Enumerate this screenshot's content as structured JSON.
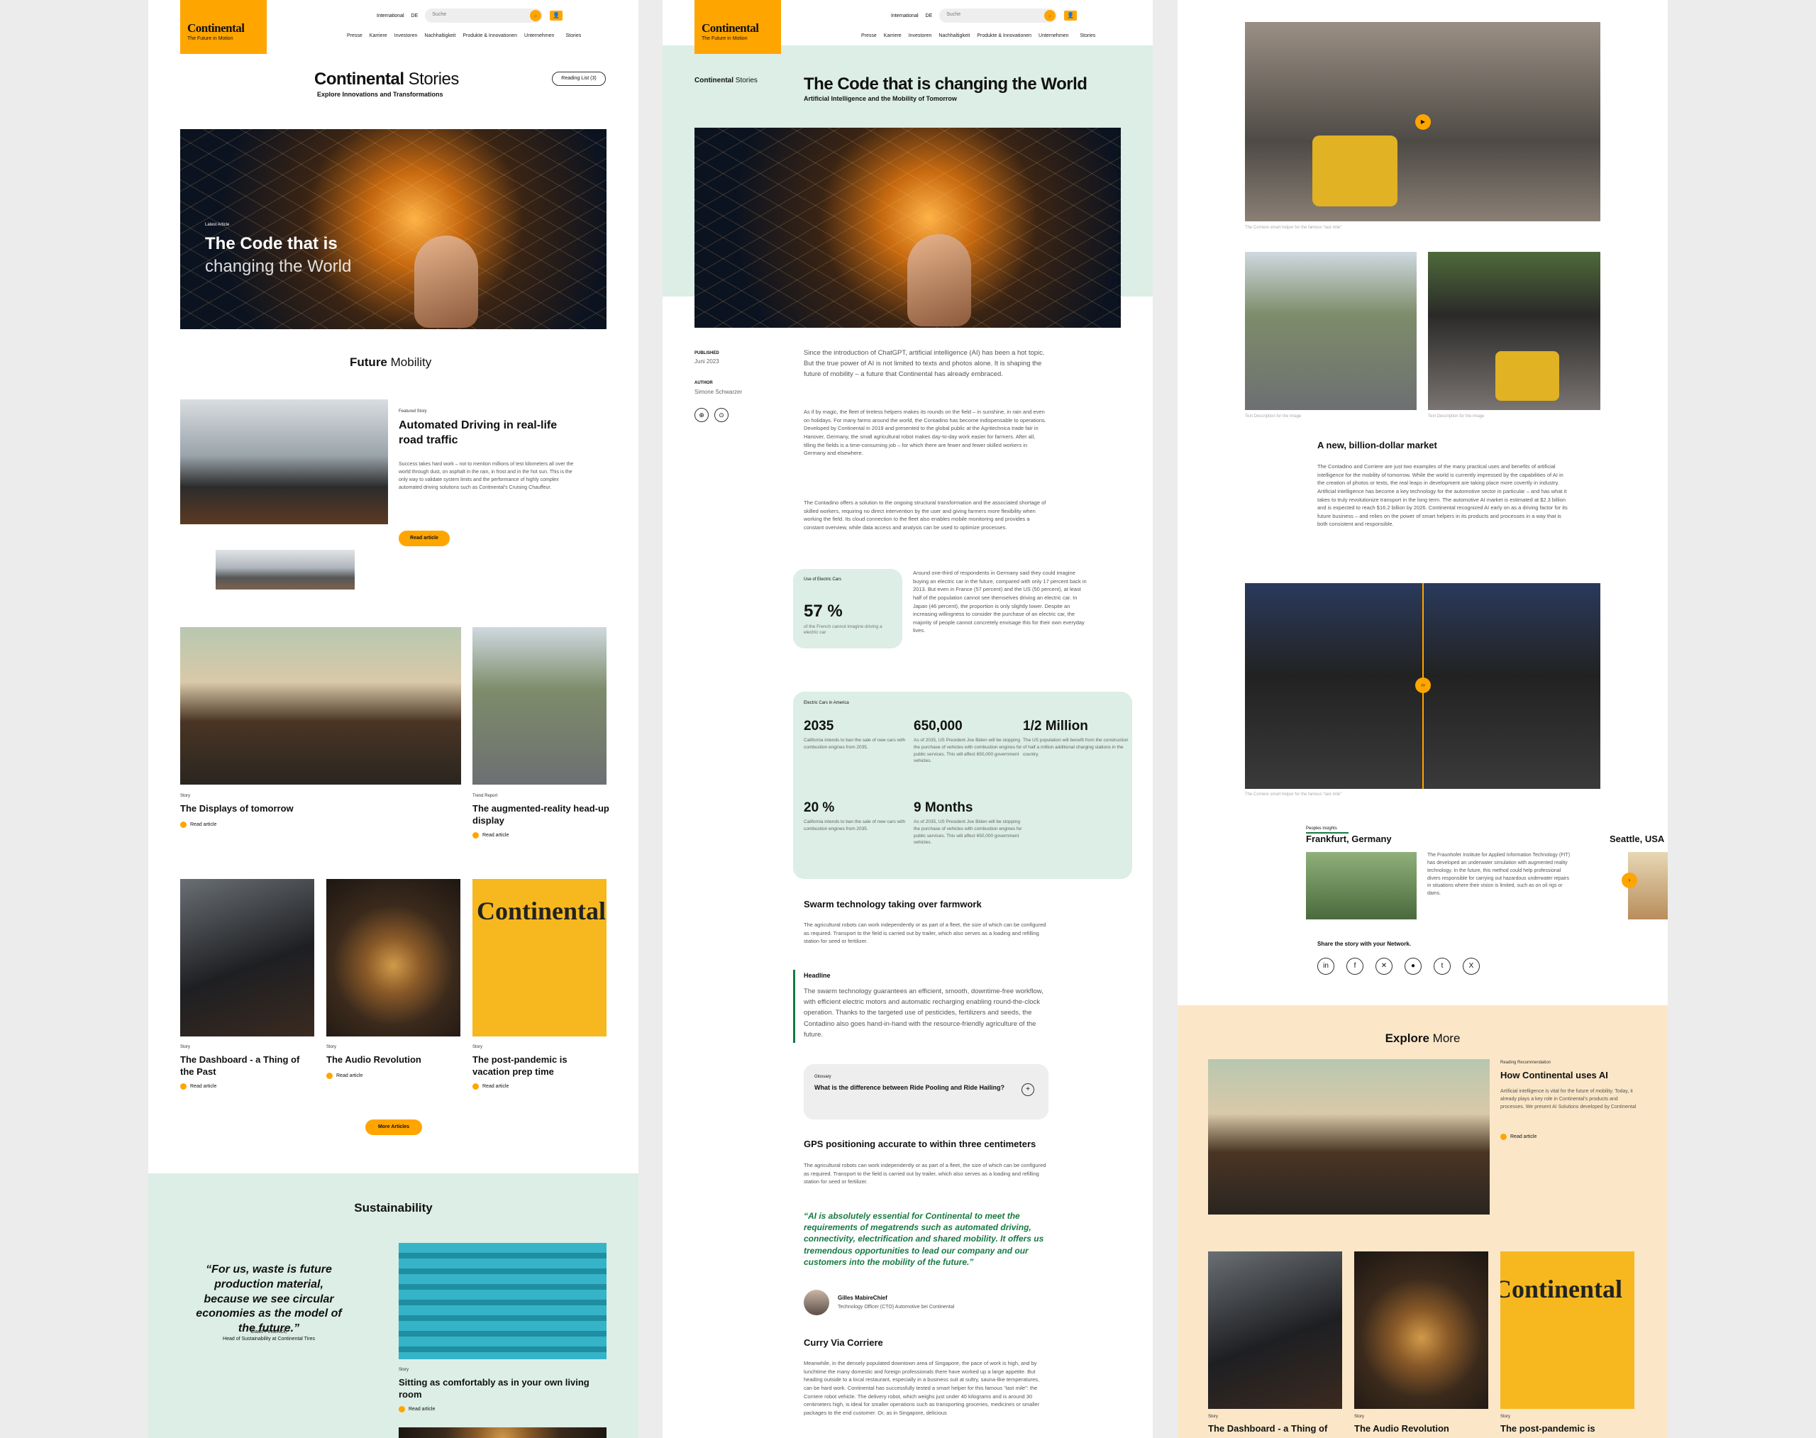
{
  "brand": {
    "name": "Continental",
    "tagline": "The Future in Motion"
  },
  "header": {
    "region": "International",
    "lang": "DE",
    "search_placeholder": "Suche",
    "nav": [
      "Presse",
      "Karriere",
      "Investoren",
      "Nachhaltigkeit",
      "Produkte & Innovationen",
      "Unternehmen"
    ],
    "stories": "Stories"
  },
  "home": {
    "title_bold": "Continental",
    "title_light": "Stories",
    "subtitle": "Explore Innovations and Transformations",
    "reading_list": "Reading List (3)",
    "hero": {
      "kicker": "Latest Article",
      "line1": "The Code that is",
      "line2": "changing the World"
    },
    "section_bold": "Future",
    "section_light": "Mobility",
    "featured": {
      "kicker": "Featured Story",
      "title": "Automated Driving in real-life road traffic",
      "body": "Success takes hard work – not to mention millions of test kilometers all over the world through dust, on asphalt in the rain, in frost and in the hot sun. This is the only way to validate system limits and the performance of highly complex automated driving solutions such as Continental’s Cruising Chauffeur.",
      "cta": "Read article"
    },
    "cards2": [
      {
        "kicker": "Story",
        "title": "The Displays of tomorrow",
        "cta": "Read article"
      },
      {
        "kicker": "Trend Report",
        "title": "The augmented-reality head-up display",
        "cta": "Read article"
      }
    ],
    "cards3": [
      {
        "kicker": "Story",
        "title": "The Dashboard - a Thing of the Past",
        "cta": "Read article"
      },
      {
        "kicker": "Story",
        "title": "The Audio Revolution",
        "cta": "Read article"
      },
      {
        "kicker": "Story",
        "title": "The post-pandemic is vacation prep time",
        "cta": "Read article"
      }
    ],
    "more": "More Articles",
    "sustain": {
      "title": "Sustainability",
      "quote": "“For us, waste is future production material, because we see circular economies as the model of the future.”",
      "author": "Claus Petschick,",
      "role": "Head of Sustainability at Continental Tires",
      "card": {
        "kicker": "Story",
        "title": "Sitting as comfortably as in your own living room",
        "cta": "Read article"
      }
    }
  },
  "article": {
    "crumb_bold": "Continental",
    "crumb_light": "Stories",
    "title": "The Code that is changing the World",
    "subtitle": "Artificial Intelligence and the Mobility of Tomorrow",
    "published_label": "PUBLISHED",
    "published": "Juni 2023",
    "author_label": "AUTHOR",
    "author": "Simone Schwarzer",
    "intro": "Since the introduction of ChatGPT, artificial intelligence (AI) has been a hot topic. But the true power of AI is not limited to texts and photos alone. It is shaping the future of mobility – a future that Continental has already embraced.",
    "p1": "As if by magic, the fleet of tireless helpers makes its rounds on the field – in sunshine, in rain and even on holidays. For many farms around the world, the Contadino has become indispensable to operations. Developed by Continental in 2019 and presented to the global public at the Agritechnica trade fair in Hanover, Germany, the small agricultural robot makes day-to-day work easier for farmers. After all, tilling the fields is a time-consuming job – for which there are fewer and fewer skilled workers in Germany and elsewhere.",
    "p2": "The Contadino offers a solution to the ongoing structural transformation and the associated shortage of skilled workers, requiring no direct intervention by the user and giving farmers more flexibility when working the field. Its cloud connection to the fleet also enables mobile monitoring and provides a constant overview, while data access and analysis can be used to optimize processes.",
    "stat1": {
      "label": "Use of Electric Cars",
      "value": "57 %",
      "desc": "of the French cannot imagine driving a electric car"
    },
    "p3": "Around one-third of respondents in Germany said they could imagine buying an electric car in the future, compared with only 17 percent back in 2013. But even in France (57 percent) and the US (50 percent), at least half of the population cannot see themselves driving an electric car. In Japan (46 percent), the proportion is only slightly lower. Despite an increasing willingness to consider the purchase of an electric car, the majority of people cannot concretely envisage this for their own everyday lives.",
    "stats_label": "Electric Cars in America",
    "stats": [
      {
        "n": "2035",
        "d": "California intends to ban the sale of new cars with combustion engines from 2035."
      },
      {
        "n": "650,000",
        "d": "As of 2035, US President Joe Biden will be stopping the purchase of vehicles with combustion engines for public services. This will affect 650,000 government vehicles."
      },
      {
        "n": "1/2 Million",
        "d": "The US population will benefit from the construction of half a million additional charging stations in the country."
      },
      {
        "n": "20 %",
        "d": "California intends to ban the sale of new cars with combustion engines from 2035."
      },
      {
        "n": "9 Months",
        "d": "As of 2035, US President Joe Biden will be stopping the purchase of vehicles with combustion engines for public services. This will affect 650,000 government vehicles."
      }
    ],
    "h_swarm": "Swarm technology taking over farmwork",
    "p_swarm": "The agricultural robots can work independently or as part of a fleet, the size of which can be configured as required. Transport to the field is carried out by trailer, which also serves as a loading and refilling station for seed or fertilizer.",
    "hl_label": "Headline",
    "hl_text": "The swarm technology guarantees an efficient, smooth, downtime-free workflow, with efficient electric motors and automatic recharging enabling round-the-clock operation. Thanks to the targeted use of pesticides, fertilizers and seeds, the Contadino also goes hand-in-hand with the resource-friendly agriculture of the future.",
    "glossary_label": "Glossary",
    "glossary_q": "What is the difference between Ride Pooling and Ride Hailing?",
    "h_gps": "GPS positioning accurate to within three centimeters",
    "p_gps": "The agricultural robots can work independently or as part of a fleet, the size of which can be configured as required. Transport to the field is carried out by trailer, which also serves as a loading and refilling station for seed or fertilizer.",
    "quote": "“AI is absolutely essential for Continental to meet the requirements of megatrends such as automated driving, connectivity, electrification and shared mobility. It offers us tremendous opportunities to lead our company and our customers into the mobility of the future.”",
    "quote_name": "Gilles MabireChief",
    "quote_role": "Technology Officer (CTO) Automotive bei Continental",
    "h_curry": "Curry Via Corriere",
    "p_curry": "Meanwhile, in the densely populated downtown area of Singapore, the pace of work is high, and by lunchtime the many domestic and foreign professionals there have worked up a large appetite. But heading outside to a local restaurant, especially in a business suit at sultry, sauna-like temperatures, can be hard work. Continental has successfully tested a smart helper for this famous “last mile”: the Corriere robot vehicle. The delivery robot, which weighs just under 40 kilograms and is around 30 centimeters high, is ideal for smaller operations such as transporting groceries, medicines or smaller packages to the end customer. Or, as in Singapore, delicious"
  },
  "continued": {
    "cap1": "The Corriere smart helper for the famous “last mile”",
    "cap2": "Text Description for the image",
    "cap3": "Text Description for the image",
    "h_market": "A new, billion-dollar market",
    "p_market": "The Contadino and Corriere are just two examples of the many practical uses and benefits of artificial intelligence for the mobility of tomorrow. While the world is currently impressed by the capabilities of AI in the creation of photos or texts, the real leaps in development are taking place more covertly in industry. Artificial intelligence has become a key technology for the automotive sector in particular – and has what it takes to truly revolutionize transport in the long term. The automotive AI market is estimated at $2.3 billion and is expected to reach $16.2 billion by 2026. Continental recognized AI early on as a driving factor for its future business – and relies on the power of smart helpers in its products and processes in a way that is both consistent and responsible.",
    "cap4": "The Corriere smart helper for the famous “last mile”",
    "insights_label": "Peoples insights",
    "city1": "Frankfurt, Germany",
    "city2": "Seattle, USA",
    "insight": "The Fraunhofer Institute for Applied Information Technology (FIT) has developed an underwater simulation with augmented reality technology. In the future, this method could help professional divers responsible for carrying out hazardous underwater repairs in situations where their vision is limited, such as on oil rigs or dams.",
    "share": "Share the story with your Network.",
    "share_icons": [
      "in",
      "f",
      "x-ing",
      "r",
      "t",
      "X"
    ],
    "explore_bold": "Explore",
    "explore_light": "More",
    "rec": {
      "kicker": "Reading Recommendation",
      "title": "How Continental uses AI",
      "body": "Artificial intelligence is vital for the future of mobility. Today, it already plays a key role in Continental’s products and processes. We present AI Solutions developed by Continental",
      "cta": "Read article"
    },
    "cards": [
      {
        "kicker": "Story",
        "title": "The Dashboard - a Thing of"
      },
      {
        "kicker": "Story",
        "title": "The Audio Revolution"
      },
      {
        "kicker": "Story",
        "title": "The post-pandemic is"
      }
    ]
  },
  "colors": {
    "accent": "#ffa500",
    "mint": "#dceee6",
    "cream": "#fbe7c8",
    "quote_green": "#157a43"
  }
}
